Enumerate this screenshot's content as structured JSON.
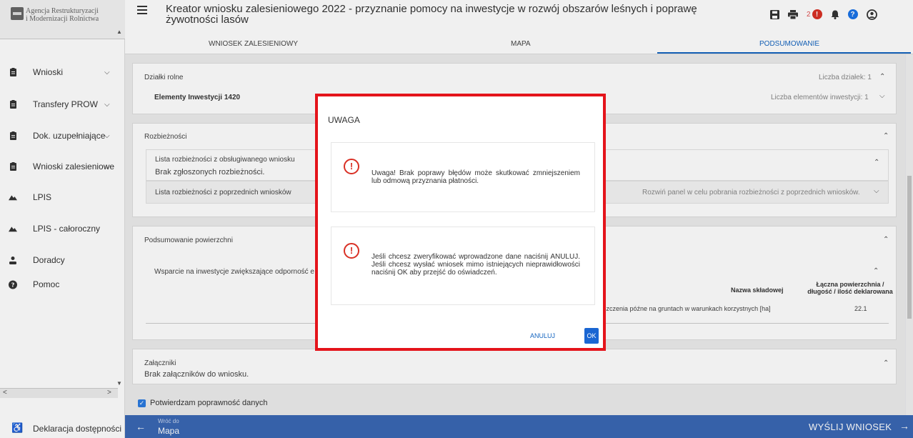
{
  "sidebar": {
    "logo_line1": "Agencja Restrukturyzacji",
    "logo_line2": "i Modernizacji Rolnictwa",
    "items": [
      {
        "label": "Wnioski",
        "icon": "clipboard-icon",
        "chevron": "⌄"
      },
      {
        "label": "Transfery PROW",
        "icon": "clipboard-icon",
        "chevron": "⌄"
      },
      {
        "label": "Dok. uzupełniające",
        "icon": "clipboard-icon",
        "chevron": "⌄"
      },
      {
        "label": "Wnioski zalesieniowe",
        "icon": "clipboard-icon",
        "chevron": "⌄"
      },
      {
        "label": "LPIS",
        "icon": "mountain-icon"
      },
      {
        "label": "LPIS - całoroczny",
        "icon": "mountain-icon"
      },
      {
        "label": "Doradcy",
        "icon": "person-icon"
      },
      {
        "label": "Pomoc",
        "icon": "help-icon"
      }
    ],
    "accessibility": "Deklaracja dostępności"
  },
  "header": {
    "title": "Kreator wniosku zalesieniowego 2022 - przyznanie pomocy na inwestycje w rozwój obszarów leśnych i poprawę żywotności lasów",
    "notification_count": "2",
    "alert_badge": "!",
    "help_badge": "?"
  },
  "tabs": [
    {
      "label": "WNIOSEK ZALESIENIOWY",
      "active": false
    },
    {
      "label": "MAPA",
      "active": false
    },
    {
      "label": "PODSUMOWANIE",
      "active": true
    }
  ],
  "main": {
    "dzialki": {
      "title": "Działki rolne",
      "count_label": "Liczba działek: 1",
      "elements_label": "Elementy Inwestycji 1420",
      "elements_count": "Liczba elementów inwestycji: 1"
    },
    "rozbieznosci": {
      "title": "Rozbieżności",
      "current_title": "Lista rozbieżności z obsługiwanego wniosku",
      "current_status": "Brak zgłoszonych rozbieżności.",
      "previous_title": "Lista rozbieżności z poprzednich wniosków",
      "previous_hint": "Rozwiń panel w celu pobrania rozbieżności z poprzednich wniosków."
    },
    "powierzchnie": {
      "title": "Podsumowanie powierzchni",
      "section": "Wsparcie na inwestycje zwiększające odporność e",
      "col_name": "Nazwa składowej",
      "col_area_line1": "Łączna powierzchnia /",
      "col_area_line2": "długość / ilość deklarowana",
      "row_name": "szczenia późne na gruntach w warunkach korzystnych [ha]",
      "row_value": "22.1"
    },
    "zalaczniki": {
      "title": "Załączniki",
      "status": "Brak załączników do wniosku."
    }
  },
  "confirm_label": "Potwierdzam poprawność danych",
  "bottombar": {
    "back_small": "Wróć do",
    "back_label": "Mapa",
    "send_label": "WYŚLIJ WNIOSEK"
  },
  "dialog": {
    "title": "UWAGA",
    "message1": "Uwaga! Brak poprawy błędów może skutkować zmniejszeniem lub odmową przyznania płatności.",
    "message2": "Jeśli chcesz zweryfikować wprowadzone dane naciśnij ANULUJ. Jeśli chcesz wysłać wniosek mimo istniejących nieprawidłowości naciśnij OK aby przejść do oświadczeń.",
    "cancel_label": "ANULUJ",
    "ok_label": "OK",
    "accent_color": "#e4141b"
  }
}
